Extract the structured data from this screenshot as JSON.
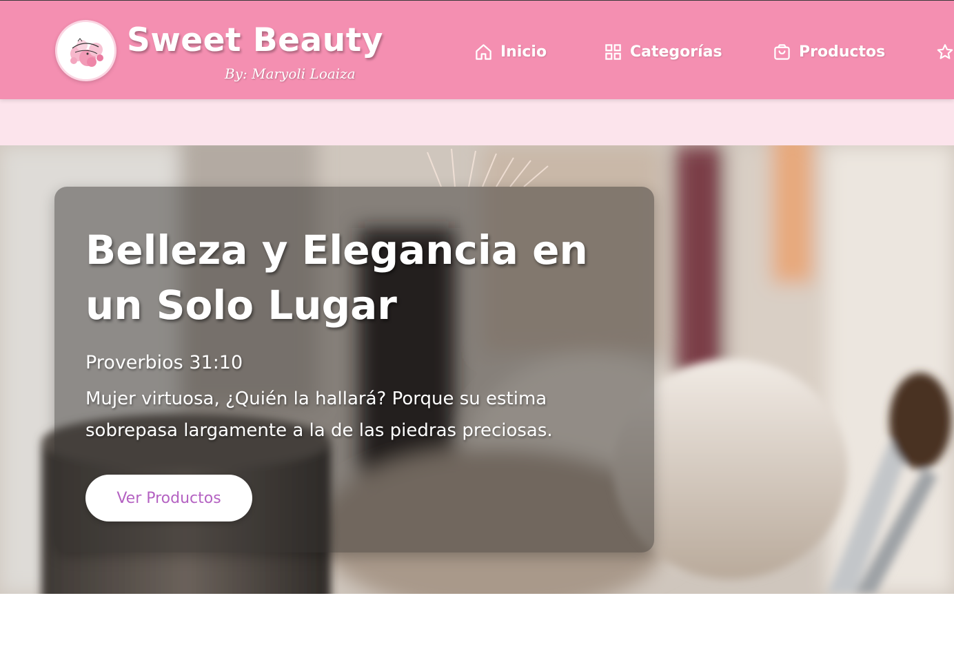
{
  "colors": {
    "navbar_bg": "#f48fb1",
    "band_bg": "#fce4ec",
    "button_text": "#b462c2",
    "text_light": "#ffffff"
  },
  "header": {
    "brand_title": "Sweet Beauty",
    "brand_subtitle": "By: Maryoli Loaiza",
    "logo_icon": "flower-logo-icon"
  },
  "nav": {
    "items": [
      {
        "label": "Inicio",
        "icon": "home-icon"
      },
      {
        "label": "Categorías",
        "icon": "grid-icon"
      },
      {
        "label": "Productos",
        "icon": "shopping-bag-icon"
      },
      {
        "label": "",
        "icon": "star-icon"
      }
    ]
  },
  "hero": {
    "title": "Belleza y Elegancia en un Solo Lugar",
    "verse_reference": "Proverbios 31:10",
    "verse_text": "Mujer virtuosa, ¿Quién la hallará? Porque su estima sobrepasa largamente a la de las piedras preciosas.",
    "cta_label": "Ver Productos",
    "background": "makeup-brushes-photo"
  }
}
